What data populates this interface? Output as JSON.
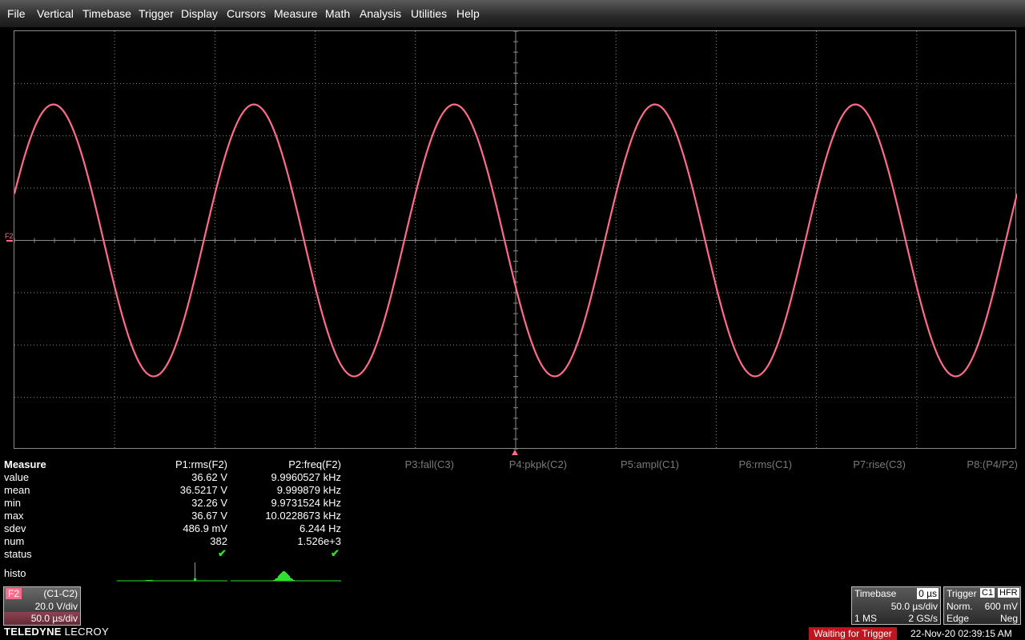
{
  "menu": [
    "File",
    "Vertical",
    "Timebase",
    "Trigger",
    "Display",
    "Cursors",
    "Measure",
    "Math",
    "Analysis",
    "Utilities",
    "Help"
  ],
  "colors": {
    "trace": "#ff6b8a",
    "grid": "#8a8a8a",
    "check": "#2de02d",
    "histo": "#2de02d",
    "status_bg": "#c0141e"
  },
  "trace": {
    "label": "F2",
    "periods_on_screen": 5,
    "amplitude_div": 2.6,
    "phase_start_deg": 20
  },
  "measure": {
    "title": "Measure",
    "row_labels": [
      "value",
      "mean",
      "min",
      "max",
      "sdev",
      "num",
      "status"
    ],
    "histo_label": "histo",
    "p1": {
      "header": "P1:rms(F2)",
      "values": [
        "36.62 V",
        "36.5217 V",
        "32.26 V",
        "36.67 V",
        "486.9 mV",
        "382"
      ],
      "status": "✔"
    },
    "p2": {
      "header": "P2:freq(F2)",
      "values": [
        "9.9960527 kHz",
        "9.999879 kHz",
        "9.9731524 kHz",
        "10.0228673 kHz",
        "6.244 Hz",
        "1.526e+3"
      ],
      "status": "✔"
    },
    "inactive": [
      "P3:fall(C3)",
      "P4:pkpk(C2)",
      "P5:ampl(C1)",
      "P6:rms(C1)",
      "P7:rise(C3)",
      "P8:(P4/P2)"
    ]
  },
  "f2_channel": {
    "label": "F2",
    "source": "(C1-C2)",
    "vdiv": "20.0 V/div",
    "tdiv": "50.0 µs/div"
  },
  "logo": {
    "brand": "TELEDYNE",
    "name": "LECROY"
  },
  "timebase": {
    "title": "Timebase",
    "delay": "0 µs",
    "tdiv": "50.0 µs/div",
    "points": "1 MS",
    "rate": "2 GS/s"
  },
  "trigger": {
    "title": "Trigger",
    "source": "C1",
    "coupling": "HFR",
    "mode": "Norm.",
    "level": "600 mV",
    "type": "Edge",
    "slope": "Neg"
  },
  "status": "Waiting for Trigger",
  "datetime": "22-Nov-20 02:39:15 AM"
}
